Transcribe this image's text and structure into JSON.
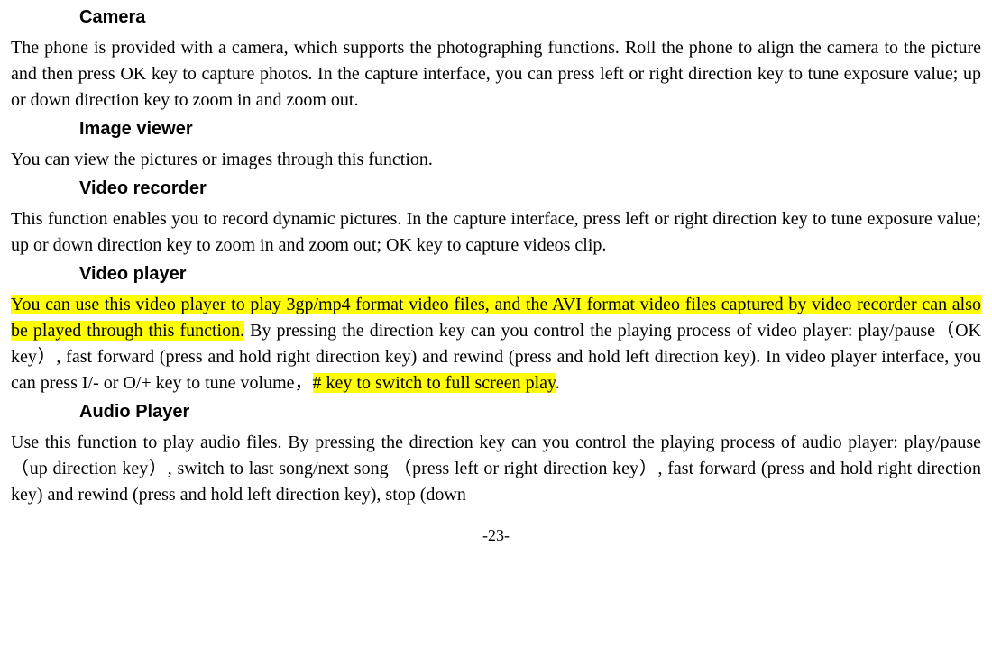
{
  "sections": {
    "camera": {
      "heading": "Camera",
      "body": "The phone is provided with a camera, which supports the photographing functions. Roll the phone to align the camera to the picture and then press OK key to capture photos. In the capture interface, you can press left or right direction key to tune exposure value; up or down direction key to zoom in and zoom out."
    },
    "image_viewer": {
      "heading": "Image viewer",
      "body": "You can view the pictures or images through this function."
    },
    "video_recorder": {
      "heading": "Video recorder",
      "body": "This function enables you to record dynamic pictures. In the capture interface, press left or right direction key to tune exposure value; up or down direction key to zoom in and zoom out; OK key to capture videos clip."
    },
    "video_player": {
      "heading": "Video player",
      "hl1": "You can use this video player to play 3gp/mp4 format video files, and the AVI format video files captured by video recorder can also be played through this function.",
      "mid": " By pressing the direction key can you control the playing process of video player: play/pause（OK key）, fast forward (press and hold right direction key) and rewind (press and hold left direction key). In video player interface, you can press I/- or O/+ key to tune volume，",
      "hl2": "# key to switch to full screen play",
      "tail": "."
    },
    "audio_player": {
      "heading": "Audio Player",
      "body": "Use this function to play audio files. By pressing the direction key can you control the playing process of audio player: play/pause（up direction key）, switch to last song/next song （press left or right direction key）, fast forward (press and hold right direction key) and rewind (press and hold left direction key), stop (down"
    }
  },
  "page_number": "-23-"
}
